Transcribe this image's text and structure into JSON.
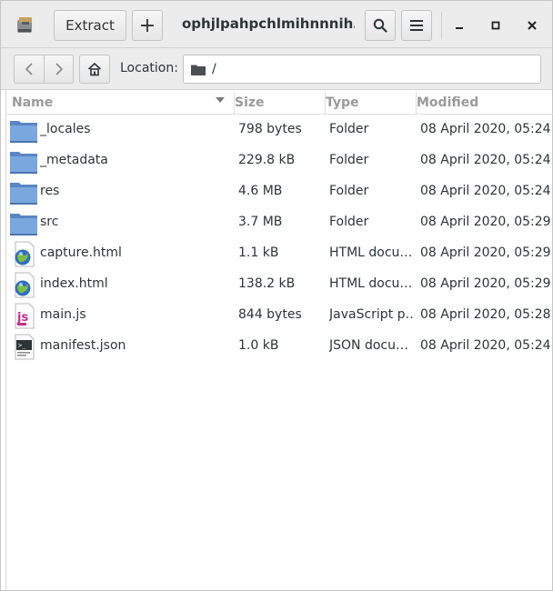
{
  "header": {
    "extract_label": "Extract",
    "add_label": "+",
    "title": "ophjlpahpchlmihnnnih…",
    "icons": {
      "app": "archive-manager-icon",
      "search": "search-icon",
      "menu": "hamburger-menu-icon",
      "minimize": "minimize-icon",
      "maximize": "maximize-icon",
      "close": "close-icon"
    }
  },
  "locationbar": {
    "label": "Location:",
    "path": "/",
    "icons": {
      "back": "chevron-left-icon",
      "forward": "chevron-right-icon",
      "home": "home-icon",
      "folder": "folder-icon"
    }
  },
  "columns": {
    "name": "Name",
    "size": "Size",
    "type": "Type",
    "modified": "Modified"
  },
  "files": [
    {
      "name": "_locales",
      "size": "798 bytes",
      "type": "Folder",
      "modified": "08 April 2020, 05:24",
      "icon": "folder"
    },
    {
      "name": "_metadata",
      "size": "229.8 kB",
      "type": "Folder",
      "modified": "08 April 2020, 05:24",
      "icon": "folder"
    },
    {
      "name": "res",
      "size": "4.6 MB",
      "type": "Folder",
      "modified": "08 April 2020, 05:24",
      "icon": "folder"
    },
    {
      "name": "src",
      "size": "3.7 MB",
      "type": "Folder",
      "modified": "08 April 2020, 05:29",
      "icon": "folder"
    },
    {
      "name": "capture.html",
      "size": "1.1 kB",
      "type": "HTML docu…",
      "modified": "08 April 2020, 05:29",
      "icon": "html"
    },
    {
      "name": "index.html",
      "size": "138.2 kB",
      "type": "HTML docu…",
      "modified": "08 April 2020, 05:29",
      "icon": "html"
    },
    {
      "name": "main.js",
      "size": "844 bytes",
      "type": "JavaScript p…",
      "modified": "08 April 2020, 05:28",
      "icon": "js"
    },
    {
      "name": "manifest.json",
      "size": "1.0 kB",
      "type": "JSON docu…",
      "modified": "08 April 2020, 05:24",
      "icon": "json"
    }
  ],
  "colors": {
    "folder": "#6d9bd6",
    "header_text": "#9a9a9a",
    "toolbar_bg": "#ececec"
  }
}
